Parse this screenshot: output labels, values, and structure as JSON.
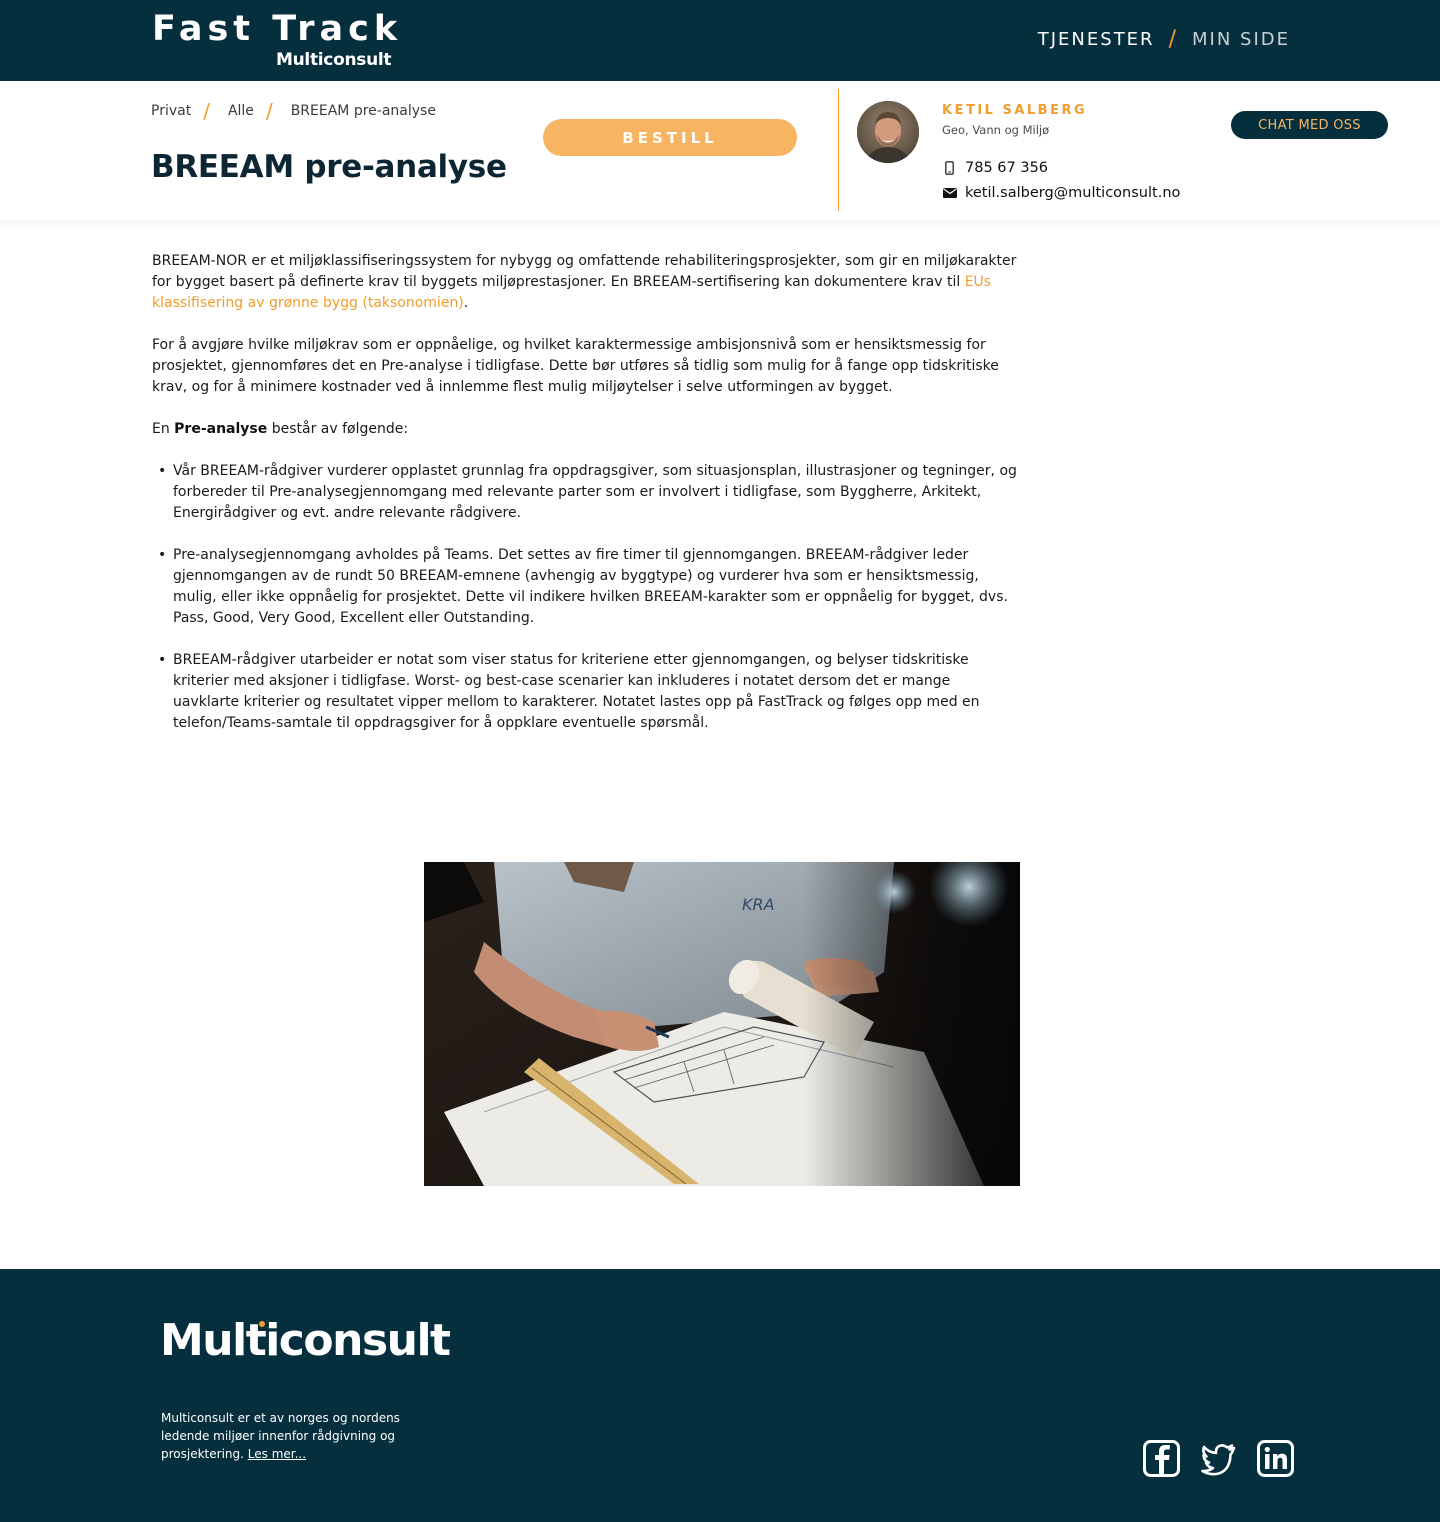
{
  "header": {
    "logo_title": "Fast Track",
    "logo_sub": "Multiconsult",
    "nav": [
      {
        "label": "TJENESTER"
      },
      {
        "label": "MIN SIDE"
      }
    ],
    "nav_separator": "/"
  },
  "breadcrumb": {
    "items": [
      "Privat",
      "Alle",
      "BREEAM pre-analyse"
    ],
    "separator": "/"
  },
  "page": {
    "title": "BREEAM pre-analyse",
    "order_label": "BESTILL"
  },
  "contact": {
    "name": "KETIL SALBERG",
    "department": "Geo, Vann og Miljø",
    "phone": "785 67 356",
    "email": "ketil.salberg@multiconsult.no",
    "chat_label": "CHAT MED  OSS"
  },
  "body": {
    "p1_text": "BREEAM-NOR er et miljøklassifiseringssystem for nybygg og omfattende rehabiliteringsprosjekter, som gir en miljøkarakter for bygget basert på definerte krav til byggets miljøprestasjoner. En BREEAM-sertifisering kan dokumentere krav til ",
    "p1_link": "EUs klassifisering av grønne bygg (taksonomien)",
    "p1_end": ".",
    "p2": "For å avgjøre hvilke miljøkrav som er oppnåelige, og hvilket karaktermessige ambisjonsnivå som er hensiktsmessig for prosjektet, gjennomføres det en Pre-analyse i tidligfase. Dette bør utføres så tidlig som mulig for å fange opp tidskritiske krav, og for å minimere kostnader ved å innlemme flest mulig miljøytelser i selve utformingen av bygget.",
    "p3_pre": "En ",
    "p3_bold": "Pre-analyse",
    "p3_post": " består av følgende:",
    "bullets": [
      "Vår BREEAM-rådgiver vurderer opplastet grunnlag fra oppdragsgiver, som situasjonsplan, illustrasjoner og tegninger, og forbereder til Pre-analysegjennomgang med relevante parter som er involvert i tidligfase, som Byggherre, Arkitekt, Energirådgiver og evt. andre relevante rådgivere.",
      "Pre-analysegjennomgang avholdes på Teams. Det settes av fire timer til gjennomgangen. BREEAM-rådgiver leder gjennomgangen av de rundt 50 BREEAM-emnene (avhengig av byggtype) og vurderer hva som er hensiktsmessig, mulig, eller ikke oppnåelig for prosjektet. Dette vil indikere hvilken BREEAM-karakter som er oppnåelig for bygget, dvs. Pass, Good, Very Good, Excellent eller Outstanding.",
      "BREEAM-rådgiver utarbeider er notat som viser status for kriteriene etter gjennomgangen, og belyser tidskritiske kriterier med aksjoner i tidligfase. Worst- og best-case scenarier kan inkluderes i notatet dersom det er mange uavklarte kriterier og resultatet vipper mellom to karakterer. Notatet lastes opp på FastTrack og følges opp med en telefon/Teams-samtale til oppdragsgiver for å oppklare eventuelle spørsmål."
    ]
  },
  "image": {
    "shirt_text": "KRA"
  },
  "footer": {
    "logo": "Multiconsult",
    "text": "Multiconsult er et av norges og nordens ledende miljøer innenfor rådgivning og prosjektering. ",
    "more_label": "Les mer...",
    "socials": [
      "facebook-icon",
      "twitter-icon",
      "linkedin-icon"
    ]
  },
  "colors": {
    "navy": "#062f3e",
    "accent": "#f29d2c",
    "button": "#f7b461"
  }
}
